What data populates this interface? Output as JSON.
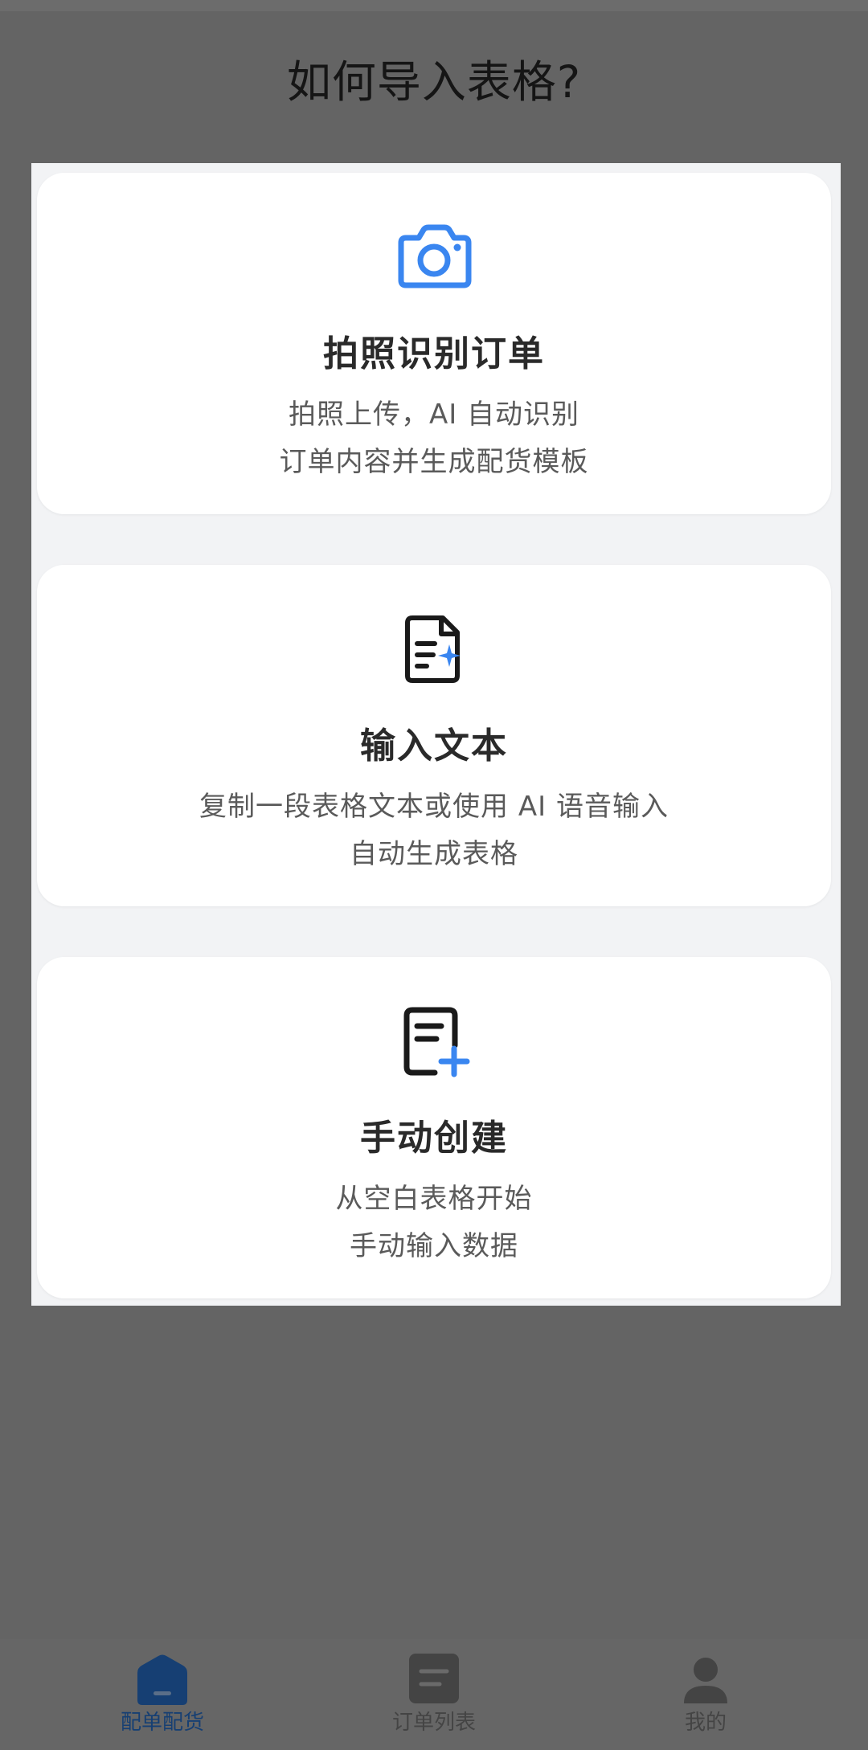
{
  "page": {
    "title": "如何导入表格?"
  },
  "cards": [
    {
      "title": "拍照识别订单",
      "desc_line1": "拍照上传，AI 自动识别",
      "desc_line2": "订单内容并生成配货模板",
      "icon": "camera-icon"
    },
    {
      "title": "输入文本",
      "desc_line1": "复制一段表格文本或使用 AI 语音输入",
      "desc_line2": "自动生成表格",
      "icon": "ai-document-icon"
    },
    {
      "title": "手动创建",
      "desc_line1": "从空白表格开始",
      "desc_line2": "手动输入数据",
      "icon": "add-document-icon"
    }
  ],
  "tabbar": {
    "items": [
      {
        "label": "配单配货",
        "icon": "home-icon",
        "active": true
      },
      {
        "label": "订单列表",
        "icon": "list-icon",
        "active": false
      },
      {
        "label": "我的",
        "icon": "user-icon",
        "active": false
      }
    ]
  },
  "colors": {
    "accent": "#3a86f0",
    "overlay": "#646464",
    "tab_active": "#163f73"
  }
}
